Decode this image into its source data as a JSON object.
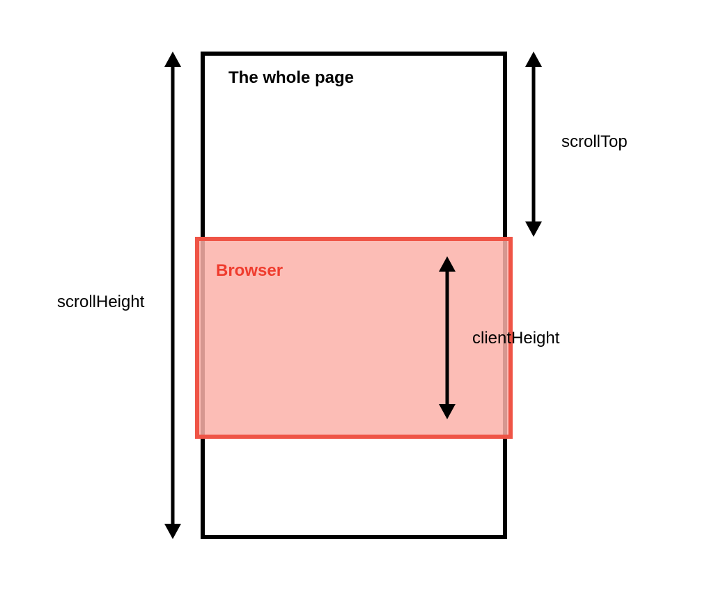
{
  "labels": {
    "page_title": "The whole page",
    "viewport_title": "Browser",
    "scroll_height": "scrollHeight",
    "scroll_top": "scrollTop",
    "client_height": "clientHeight"
  },
  "colors": {
    "page_border": "#000000",
    "viewport_border": "#ef5446",
    "viewport_fill": "#fab2a9"
  },
  "geometry_note": "Diagram of document.documentElement scroll metrics: scrollHeight = full page height; scrollTop = distance scrolled; clientHeight = visible viewport height."
}
